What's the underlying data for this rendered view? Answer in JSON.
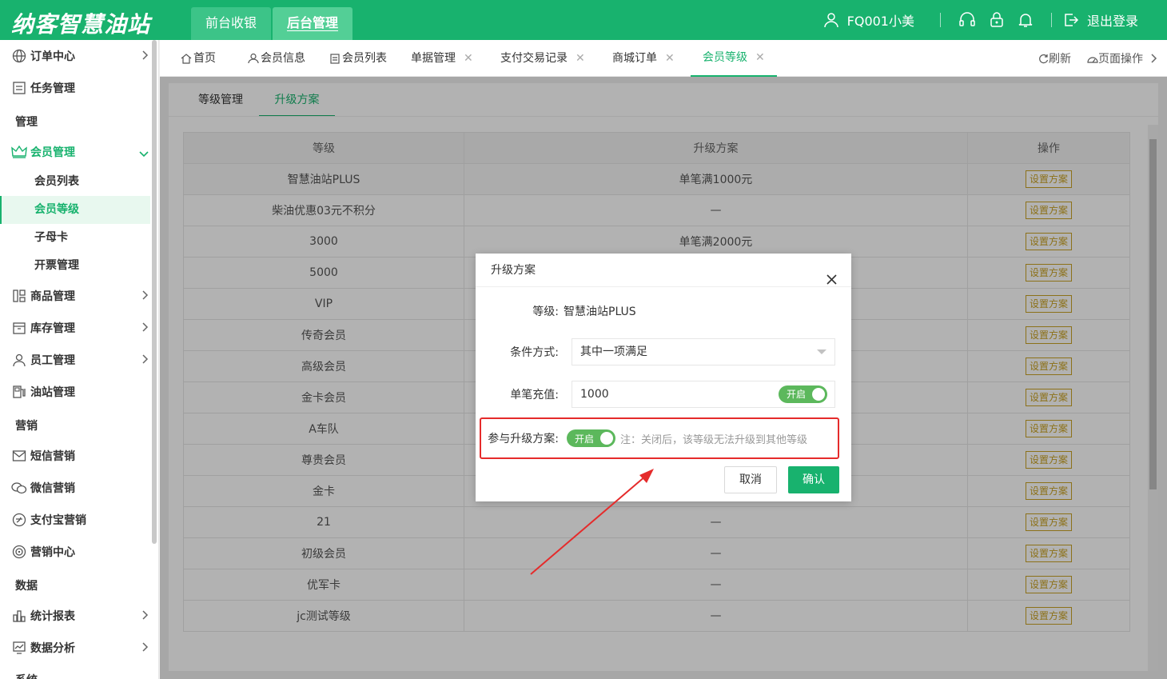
{
  "brand": {
    "logo_text": "纳客智慧油站"
  },
  "top_tabs": [
    {
      "label": "前台收银"
    },
    {
      "label": "后台管理"
    }
  ],
  "top_right": {
    "user": "FQ001小美",
    "logout": "退出登录"
  },
  "sidebar": {
    "items": [
      {
        "label": "订单中心",
        "icon": "globe-icon"
      },
      {
        "label": "任务管理",
        "icon": "task-icon"
      },
      {
        "label": "会员管理",
        "icon": "crown-icon"
      },
      {
        "label": "商品管理",
        "icon": "goods-icon"
      },
      {
        "label": "库存管理",
        "icon": "inventory-icon"
      },
      {
        "label": "员工管理",
        "icon": "user-icon"
      },
      {
        "label": "油站管理",
        "icon": "fuel-icon"
      },
      {
        "label": "短信营销",
        "icon": "mail-icon"
      },
      {
        "label": "微信营销",
        "icon": "wechat-icon"
      },
      {
        "label": "支付宝营销",
        "icon": "alipay-icon"
      },
      {
        "label": "营销中心",
        "icon": "target-icon"
      },
      {
        "label": "统计报表",
        "icon": "chart-icon"
      },
      {
        "label": "数据分析",
        "icon": "analysis-icon"
      }
    ],
    "groups": [
      {
        "label": "管理"
      },
      {
        "label": "营销"
      },
      {
        "label": "数据"
      },
      {
        "label": "系统"
      }
    ],
    "member_sub": [
      {
        "label": "会员列表"
      },
      {
        "label": "会员等级"
      },
      {
        "label": "子母卡"
      },
      {
        "label": "开票管理"
      }
    ]
  },
  "tabs": [
    {
      "label": "首页"
    },
    {
      "label": "会员信息"
    },
    {
      "label": "会员列表"
    },
    {
      "label": "单据管理"
    },
    {
      "label": "支付交易记录"
    },
    {
      "label": "商城订单"
    },
    {
      "label": "会员等级"
    }
  ],
  "tab_tools": {
    "refresh": "刷新",
    "page_ops": "页面操作"
  },
  "subtabs": [
    {
      "label": "等级管理"
    },
    {
      "label": "升级方案"
    }
  ],
  "table": {
    "headers": [
      "等级",
      "升级方案",
      "操作"
    ],
    "action_label": "设置方案",
    "rows": [
      {
        "level": "智慧油站PLUS",
        "plan": "单笔满1000元"
      },
      {
        "level": "柴油优惠03元不积分",
        "plan": "—"
      },
      {
        "level": "3000",
        "plan": "单笔满2000元"
      },
      {
        "level": "5000",
        "plan": ""
      },
      {
        "level": "VIP",
        "plan": ""
      },
      {
        "level": "传奇会员",
        "plan": ""
      },
      {
        "level": "高级会员",
        "plan": ""
      },
      {
        "level": "金卡会员",
        "plan": ""
      },
      {
        "level": "A车队",
        "plan": ""
      },
      {
        "level": "尊贵会员",
        "plan": ""
      },
      {
        "level": "金卡",
        "plan": ""
      },
      {
        "level": "21",
        "plan": "—"
      },
      {
        "level": "初级会员",
        "plan": "—"
      },
      {
        "level": "优军卡",
        "plan": "—"
      },
      {
        "level": "jc测试等级",
        "plan": "—"
      }
    ]
  },
  "modal": {
    "title": "升级方案",
    "level_label": "等级:",
    "level_value": "智慧油站PLUS",
    "cond_label": "条件方式:",
    "cond_value": "其中一项满足",
    "recharge_label": "单笔充值:",
    "recharge_value": "1000",
    "switch_on": "开启",
    "join_label": "参与升级方案:",
    "note": "注：关闭后，该等级无法升级到其他等级",
    "cancel": "取消",
    "confirm": "确认",
    "highlight_color": "#e52b2b"
  }
}
